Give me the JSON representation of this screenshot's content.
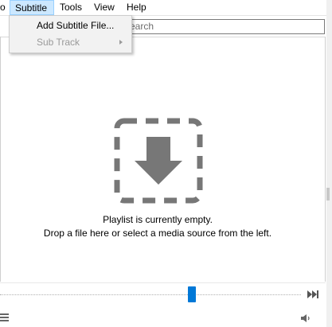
{
  "menubar": {
    "items": [
      {
        "label": "o"
      },
      {
        "label": "Subtitle"
      },
      {
        "label": "Tools"
      },
      {
        "label": "View"
      },
      {
        "label": "Help"
      }
    ],
    "active_item": "Subtitle"
  },
  "subtitle_menu": {
    "items": [
      {
        "label": "Add Subtitle File...",
        "enabled": true
      },
      {
        "label": "Sub Track",
        "enabled": false,
        "has_submenu": true
      }
    ]
  },
  "search": {
    "placeholder": "Search",
    "visible_text": "earch"
  },
  "playlist": {
    "empty_line1": "Playlist is currently empty.",
    "empty_line2": "Drop a file here or select a media source from the left."
  },
  "controls": {
    "seek_position_fraction": 0.62
  },
  "colors": {
    "accent": "#0078d7",
    "menu_highlight": "#cce8ff",
    "drop_icon": "#777777"
  },
  "icons": [
    "down-arrow-drop-icon",
    "next-frame-icon",
    "playlist-icon",
    "volume-icon",
    "submenu-arrow-icon"
  ]
}
